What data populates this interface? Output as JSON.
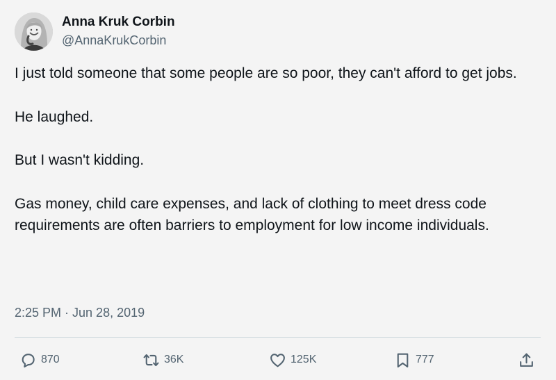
{
  "author": {
    "display_name": "Anna Kruk Corbin",
    "handle": "@AnnaKrukCorbin"
  },
  "tweet": {
    "paragraphs": [
      "I just told someone that some people are so poor, they can't afford to get jobs.",
      "He laughed.",
      "But I wasn't kidding.",
      "Gas money, child care expenses, and lack of clothing to meet dress code requirements are often barriers to employment for low income individuals."
    ],
    "timestamp": "2:25 PM · Jun 28, 2019"
  },
  "actions": {
    "replies": "870",
    "reposts": "36K",
    "likes": "125K",
    "bookmarks": "777"
  },
  "icons": {
    "reply": "speech-bubble-icon",
    "repost": "retweet-arrows-icon",
    "like": "heart-outline-icon",
    "bookmark": "bookmark-outline-icon",
    "share": "share-upload-icon"
  },
  "colors": {
    "background": "#f4f4f4",
    "text": "#0f1419",
    "secondary": "#536471",
    "divider": "#cfd9de"
  }
}
